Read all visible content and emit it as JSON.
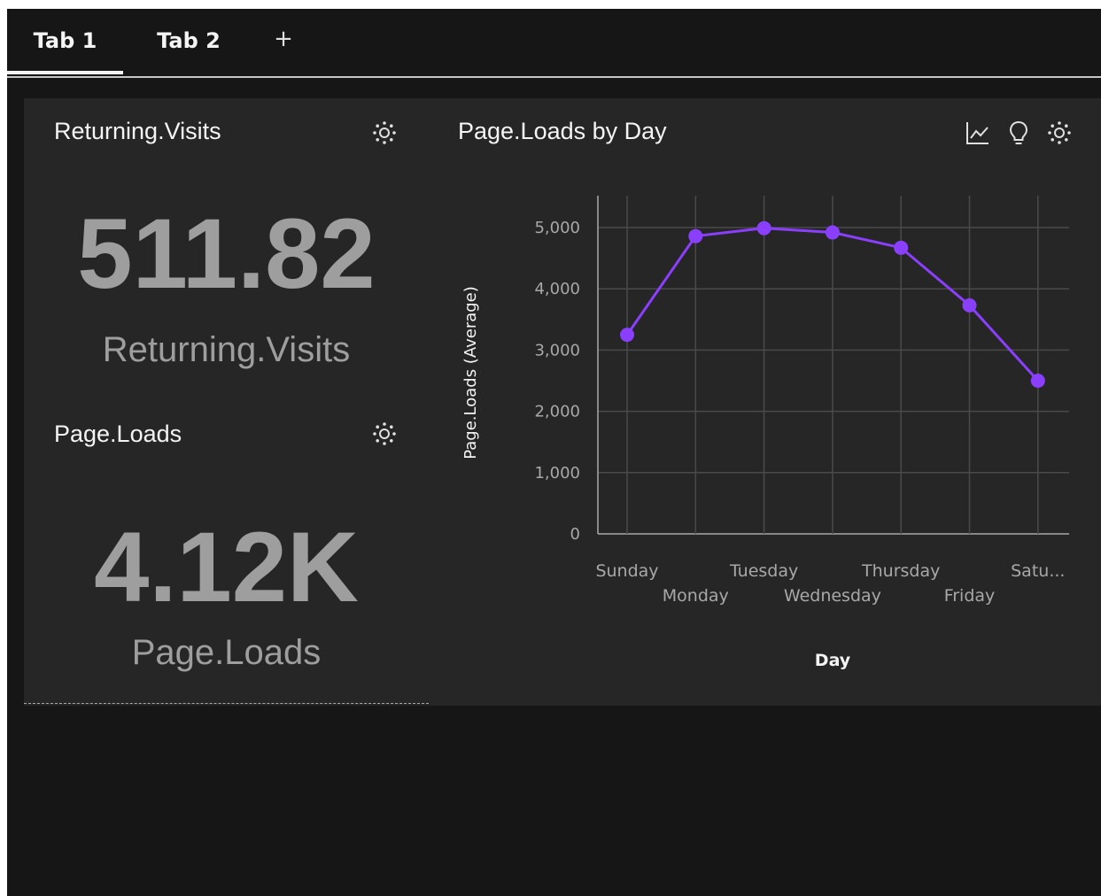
{
  "tabs": [
    {
      "label": "Tab 1",
      "active": true
    },
    {
      "label": "Tab 2",
      "active": false
    }
  ],
  "add_tab_label": "+",
  "widgets": {
    "returning_visits": {
      "title": "Returning.Visits",
      "value": "511.82",
      "label": "Returning.Visits"
    },
    "page_loads": {
      "title": "Page.Loads",
      "value": "4.12K",
      "label": "Page.Loads"
    },
    "chart_widget": {
      "title": "Page.Loads by Day",
      "icons": [
        "line-chart-icon",
        "lightbulb-icon",
        "settings-icon"
      ]
    }
  },
  "colors": {
    "accent": "#8a3ffc",
    "background": "#161616",
    "panel": "#262626",
    "text": "#f4f4f4",
    "muted": "#9e9e9e"
  },
  "chart_data": {
    "type": "line",
    "title": "Page.Loads by Day",
    "xlabel": "Day",
    "ylabel": "Page.Loads (Average)",
    "categories": [
      "Sunday",
      "Monday",
      "Tuesday",
      "Wednesday",
      "Thursday",
      "Friday",
      "Satu..."
    ],
    "series": [
      {
        "values": [
          3250,
          4860,
          4990,
          4920,
          4670,
          3730,
          2500
        ]
      }
    ],
    "ylim": [
      0,
      5000
    ],
    "yticks": [
      "0",
      "1,000",
      "2,000",
      "3,000",
      "4,000",
      "5,000"
    ],
    "ytick_values": [
      0,
      1000,
      2000,
      3000,
      4000,
      5000
    ],
    "grid": true
  }
}
